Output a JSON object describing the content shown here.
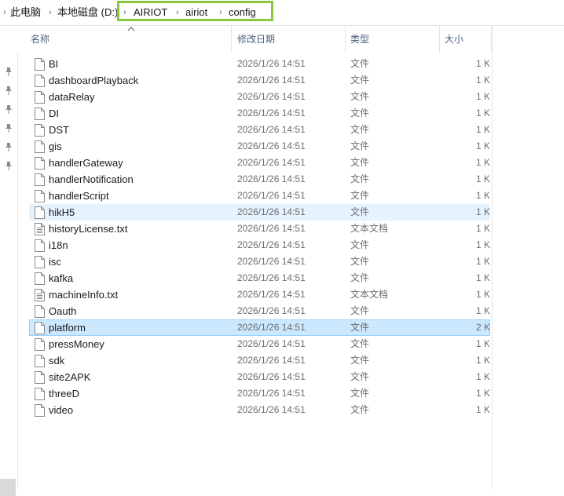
{
  "breadcrumb": [
    {
      "label": "此电脑"
    },
    {
      "label": "本地磁盘 (D:)"
    },
    {
      "label": "AIRIOT"
    },
    {
      "label": "airiot"
    },
    {
      "label": "config"
    }
  ],
  "columns": {
    "name": "名称",
    "date": "修改日期",
    "type": "类型",
    "size": "大小"
  },
  "files": [
    {
      "name": "BI",
      "date": "2026/1/26 14:51",
      "type": "文件",
      "size": "1 K",
      "icon": "file-icon"
    },
    {
      "name": "dashboardPlayback",
      "date": "2026/1/26 14:51",
      "type": "文件",
      "size": "1 K",
      "icon": "file-icon"
    },
    {
      "name": "dataRelay",
      "date": "2026/1/26 14:51",
      "type": "文件",
      "size": "1 K",
      "icon": "file-icon"
    },
    {
      "name": "DI",
      "date": "2026/1/26 14:51",
      "type": "文件",
      "size": "1 K",
      "icon": "file-icon"
    },
    {
      "name": "DST",
      "date": "2026/1/26 14:51",
      "type": "文件",
      "size": "1 K",
      "icon": "file-icon"
    },
    {
      "name": "gis",
      "date": "2026/1/26 14:51",
      "type": "文件",
      "size": "1 K",
      "icon": "file-icon"
    },
    {
      "name": "handlerGateway",
      "date": "2026/1/26 14:51",
      "type": "文件",
      "size": "1 K",
      "icon": "file-icon"
    },
    {
      "name": "handlerNotification",
      "date": "2026/1/26 14:51",
      "type": "文件",
      "size": "1 K",
      "icon": "file-icon"
    },
    {
      "name": "handlerScript",
      "date": "2026/1/26 14:51",
      "type": "文件",
      "size": "1 K",
      "icon": "file-icon"
    },
    {
      "name": "hikH5",
      "date": "2026/1/26 14:51",
      "type": "文件",
      "size": "1 K",
      "icon": "file-icon",
      "state": "hover"
    },
    {
      "name": "historyLicense.txt",
      "date": "2026/1/26 14:51",
      "type": "文本文档",
      "size": "1 K",
      "icon": "text-file-icon"
    },
    {
      "name": "i18n",
      "date": "2026/1/26 14:51",
      "type": "文件",
      "size": "1 K",
      "icon": "file-icon"
    },
    {
      "name": "isc",
      "date": "2026/1/26 14:51",
      "type": "文件",
      "size": "1 K",
      "icon": "file-icon"
    },
    {
      "name": "kafka",
      "date": "2026/1/26 14:51",
      "type": "文件",
      "size": "1 K",
      "icon": "file-icon"
    },
    {
      "name": "machineInfo.txt",
      "date": "2026/1/26 14:51",
      "type": "文本文档",
      "size": "1 K",
      "icon": "text-file-icon"
    },
    {
      "name": "Oauth",
      "date": "2026/1/26 14:51",
      "type": "文件",
      "size": "1 K",
      "icon": "file-icon"
    },
    {
      "name": "platform",
      "date": "2026/1/26 14:51",
      "type": "文件",
      "size": "2 K",
      "icon": "file-icon",
      "state": "selected"
    },
    {
      "name": "pressMoney",
      "date": "2026/1/26 14:51",
      "type": "文件",
      "size": "1 K",
      "icon": "file-icon"
    },
    {
      "name": "sdk",
      "date": "2026/1/26 14:51",
      "type": "文件",
      "size": "1 K",
      "icon": "file-icon"
    },
    {
      "name": "site2APK",
      "date": "2026/1/26 14:51",
      "type": "文件",
      "size": "1 K",
      "icon": "file-icon"
    },
    {
      "name": "threeD",
      "date": "2026/1/26 14:51",
      "type": "文件",
      "size": "1 K",
      "icon": "file-icon"
    },
    {
      "name": "video",
      "date": "2026/1/26 14:51",
      "type": "文件",
      "size": "1 K",
      "icon": "file-icon"
    }
  ],
  "pins": [
    {
      "icon": "pin-icon"
    },
    {
      "icon": "pin-icon"
    },
    {
      "icon": "pin-icon"
    },
    {
      "icon": "pin-icon"
    },
    {
      "icon": "pin-icon"
    },
    {
      "icon": "pin-icon"
    }
  ],
  "colors": {
    "highlight_box": "#8cc63f",
    "hover_row": "#e5f3ff",
    "selected_row": "#cce8ff",
    "selected_border": "#99d1ff",
    "header_text": "#4c607a"
  }
}
